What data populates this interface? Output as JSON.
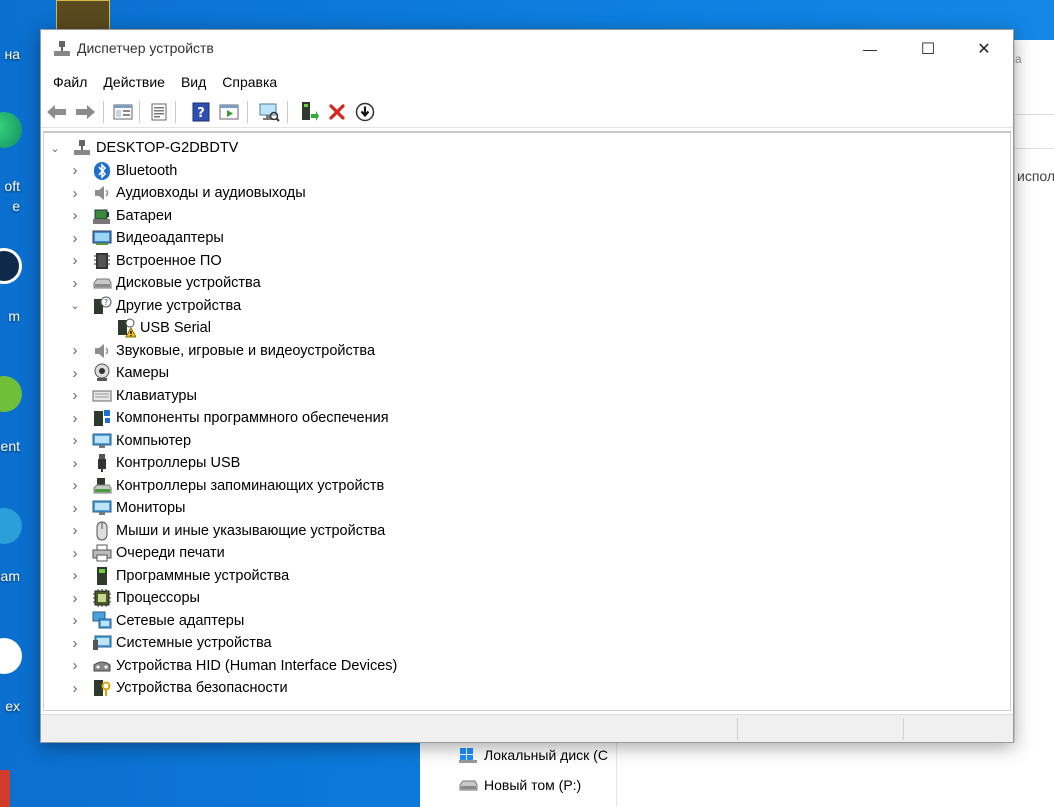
{
  "window": {
    "title": "Диспетчер устройств",
    "controls": {
      "minimize": "—",
      "maximize": "☐",
      "close": "✕"
    }
  },
  "menu": [
    "Файл",
    "Действие",
    "Вид",
    "Справка"
  ],
  "toolbar": [
    "back-arrow-icon",
    "forward-arrow-icon",
    "show-hide-tree-icon",
    "properties-icon",
    "help-icon",
    "run-action-icon",
    "scan-hardware-icon",
    "update-driver-icon",
    "uninstall-device-icon",
    "disable-device-icon"
  ],
  "tree": {
    "root": "DESKTOP-G2DBDTV",
    "categories": [
      {
        "label": "Bluetooth",
        "icon": "bluetooth-icon"
      },
      {
        "label": "Аудиовходы и аудиовыходы",
        "icon": "speaker-icon"
      },
      {
        "label": "Батареи",
        "icon": "battery-icon"
      },
      {
        "label": "Видеоадаптеры",
        "icon": "display-adapter-icon"
      },
      {
        "label": "Встроенное ПО",
        "icon": "firmware-chip-icon"
      },
      {
        "label": "Дисковые устройства",
        "icon": "disk-drive-icon"
      },
      {
        "label": "Другие устройства",
        "icon": "unknown-device-icon",
        "expanded": true,
        "children": [
          {
            "label": "USB Serial",
            "icon": "warning-device-icon"
          }
        ]
      },
      {
        "label": "Звуковые, игровые и видеоустройства",
        "icon": "sound-icon"
      },
      {
        "label": "Камеры",
        "icon": "webcam-icon"
      },
      {
        "label": "Клавиатуры",
        "icon": "keyboard-icon"
      },
      {
        "label": "Компоненты программного обеспечения",
        "icon": "software-component-icon"
      },
      {
        "label": "Компьютер",
        "icon": "computer-icon"
      },
      {
        "label": "Контроллеры USB",
        "icon": "usb-icon"
      },
      {
        "label": "Контроллеры запоминающих устройств",
        "icon": "storage-controller-icon"
      },
      {
        "label": "Мониторы",
        "icon": "monitor-icon"
      },
      {
        "label": "Мыши и иные указывающие устройства",
        "icon": "mouse-icon"
      },
      {
        "label": "Очереди печати",
        "icon": "printer-icon"
      },
      {
        "label": "Программные устройства",
        "icon": "software-device-icon"
      },
      {
        "label": "Процессоры",
        "icon": "processor-icon"
      },
      {
        "label": "Сетевые адаптеры",
        "icon": "network-adapter-icon"
      },
      {
        "label": "Системные устройства",
        "icon": "system-device-icon"
      },
      {
        "label": "Устройства HID (Human Interface Devices)",
        "icon": "hid-icon"
      },
      {
        "label": "Устройства безопасности",
        "icon": "security-device-icon"
      }
    ]
  },
  "desktop": {
    "icons": [
      "на",
      "oft\ne",
      "m",
      "ent",
      "am",
      "ex"
    ],
    "background_window": {
      "fragment_top": "а",
      "fragment": "исполо"
    },
    "drives": [
      "Локальный диск (C",
      "Новый том (P:)"
    ]
  },
  "colors": {
    "desktop": "#0b78d8",
    "error_red": "#d8261f",
    "accent_blue": "#1565c0"
  }
}
